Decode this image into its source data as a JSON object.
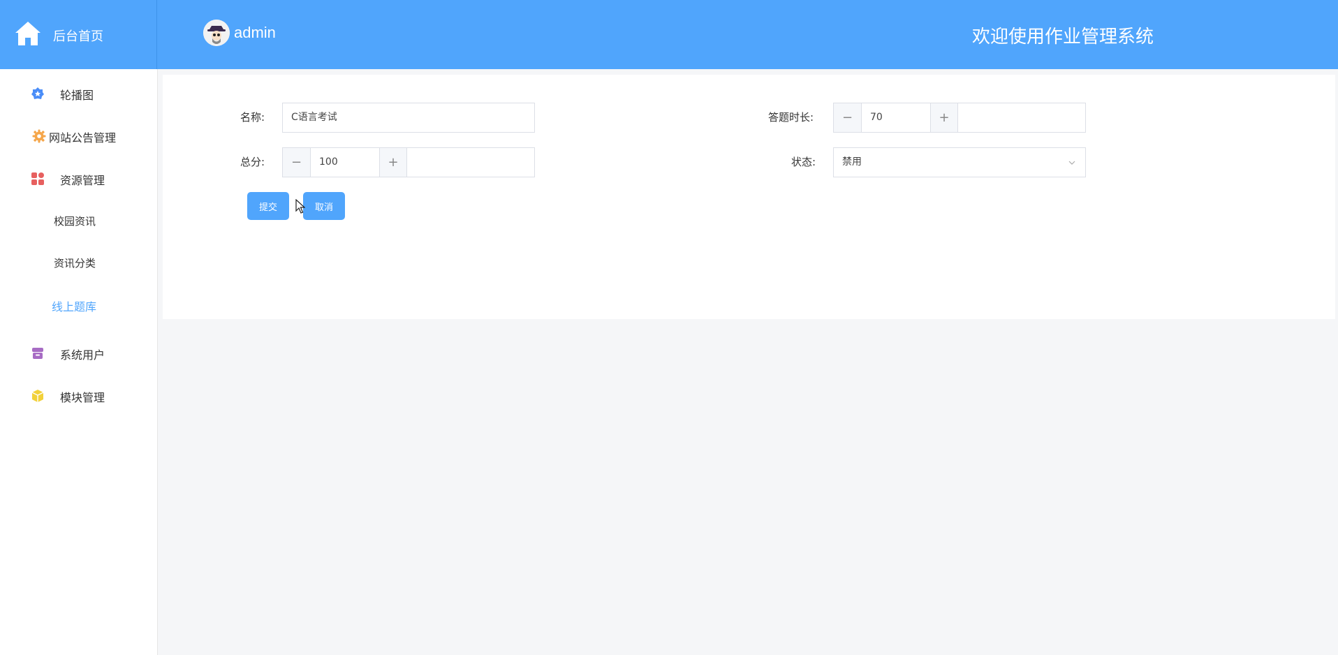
{
  "header": {
    "brand_label": "后台首页",
    "user_name": "admin",
    "site_title": "欢迎使用作业管理系统",
    "bg_color": "#50a5fc"
  },
  "sidebar": {
    "items": [
      {
        "label": "轮播图",
        "icon": "star-badge-icon",
        "color": "#4a8df8"
      },
      {
        "label": "网站公告管理",
        "icon": "gear-icon",
        "color": "#f5a64a"
      },
      {
        "label": "资源管理",
        "icon": "grid-icon",
        "color": "#e7605f"
      },
      {
        "label": "系统用户",
        "icon": "archive-icon",
        "color": "#a76cc4"
      },
      {
        "label": "模块管理",
        "icon": "cube-icon",
        "color": "#f2d13a"
      }
    ],
    "sub_items": [
      {
        "label": "校园资讯"
      },
      {
        "label": "资讯分类"
      },
      {
        "label": "线上题库",
        "active": true
      }
    ],
    "active_color": "#50a5fc"
  },
  "form": {
    "name_label": "名称:",
    "name_value": "C语言考试",
    "duration_label": "答题时长:",
    "duration_value": "70",
    "score_label": "总分:",
    "score_value": "100",
    "status_label": "状态:",
    "status_value": "禁用",
    "minus_symbol": "−",
    "plus_symbol": "+",
    "submit_label": "提交",
    "cancel_label": "取消"
  }
}
